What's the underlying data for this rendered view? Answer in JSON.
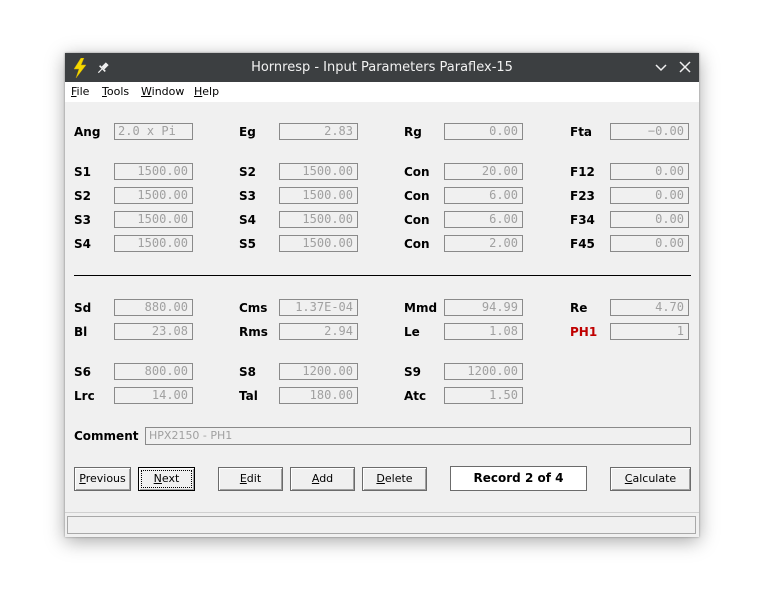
{
  "window": {
    "title": "Hornresp - Input Parameters Paraflex-15"
  },
  "menu": {
    "items": [
      {
        "key": "file",
        "accel": "F",
        "rest": "ile"
      },
      {
        "key": "tools",
        "accel": "T",
        "rest": "ools"
      },
      {
        "key": "window",
        "accel": "W",
        "rest": "indow"
      },
      {
        "key": "help",
        "accel": "H",
        "rest": "elp"
      }
    ]
  },
  "params": {
    "ang": {
      "label": "Ang",
      "value": "2.0 x Pi"
    },
    "eg": {
      "label": "Eg",
      "value": "2.83"
    },
    "rg": {
      "label": "Rg",
      "value": "0.00"
    },
    "fta": {
      "label": "Fta",
      "value": "−0.00"
    },
    "s1a": {
      "label": "S1",
      "value": "1500.00"
    },
    "s2b": {
      "label": "S2",
      "value": "1500.00"
    },
    "con1": {
      "label": "Con",
      "value": "20.00"
    },
    "f12": {
      "label": "F12",
      "value": "0.00"
    },
    "s2a": {
      "label": "S2",
      "value": "1500.00"
    },
    "s3b": {
      "label": "S3",
      "value": "1500.00"
    },
    "con2": {
      "label": "Con",
      "value": "6.00"
    },
    "f23": {
      "label": "F23",
      "value": "0.00"
    },
    "s3a": {
      "label": "S3",
      "value": "1500.00"
    },
    "s4b": {
      "label": "S4",
      "value": "1500.00"
    },
    "con3": {
      "label": "Con",
      "value": "6.00"
    },
    "f34": {
      "label": "F34",
      "value": "0.00"
    },
    "s4a": {
      "label": "S4",
      "value": "1500.00"
    },
    "s5b": {
      "label": "S5",
      "value": "1500.00"
    },
    "con4": {
      "label": "Con",
      "value": "2.00"
    },
    "f45": {
      "label": "F45",
      "value": "0.00"
    },
    "sd": {
      "label": "Sd",
      "value": "880.00"
    },
    "cms": {
      "label": "Cms",
      "value": "1.37E-04"
    },
    "mmd": {
      "label": "Mmd",
      "value": "94.99"
    },
    "re": {
      "label": "Re",
      "value": "4.70"
    },
    "bl": {
      "label": "Bl",
      "value": "23.08"
    },
    "rms": {
      "label": "Rms",
      "value": "2.94"
    },
    "le": {
      "label": "Le",
      "value": "1.08"
    },
    "ph1": {
      "label": "PH1",
      "value": "1"
    },
    "s6": {
      "label": "S6",
      "value": "800.00"
    },
    "s8": {
      "label": "S8",
      "value": "1200.00"
    },
    "s9": {
      "label": "S9",
      "value": "1200.00"
    },
    "lrc": {
      "label": "Lrc",
      "value": "14.00"
    },
    "tal": {
      "label": "Tal",
      "value": "180.00"
    },
    "atc": {
      "label": "Atc",
      "value": "1.50"
    }
  },
  "comment": {
    "label": "Comment",
    "value": "HPX2150 - PH1"
  },
  "buttons": {
    "previous": {
      "accel": "P",
      "rest": "revious"
    },
    "next": {
      "accel": "N",
      "rest": "ext"
    },
    "edit": {
      "accel": "E",
      "rest": "dit"
    },
    "add": {
      "accel": "A",
      "rest": "dd"
    },
    "delete": {
      "accel": "D",
      "rest": "elete"
    },
    "calculate": {
      "accel": "C",
      "rest": "alculate"
    }
  },
  "record": {
    "text": "Record 2 of 4"
  },
  "colors": {
    "titlebar": "#3c3f41",
    "background": "#f0f0f0",
    "field_text": "#a0a0a0",
    "highlight_label": "#c00000"
  }
}
